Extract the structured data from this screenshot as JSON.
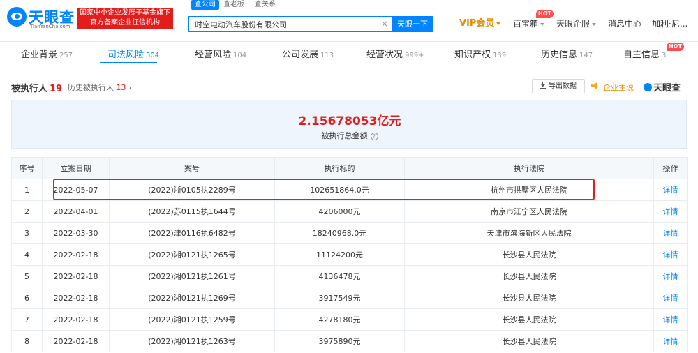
{
  "header": {
    "logo_name": "天眼查",
    "logo_domain": "TianYanCha.com",
    "gov_badge_line1": "国家中小企业发展子基金旗下",
    "gov_badge_line2": "官方备案企业征信机构",
    "search_tabs": [
      "查公司",
      "查老板",
      "查关系"
    ],
    "search_value": "时空电动汽车股份有限公司",
    "search_button": "天眼一下",
    "nav": {
      "vip": "VIP会员",
      "treasure": "百宝箱",
      "treasure_badge": "HOT",
      "enterprise": "天眼企服",
      "messages": "消息中心",
      "user": "加利·尼..."
    }
  },
  "tabs": [
    {
      "label": "企业背景",
      "count": "257"
    },
    {
      "label": "司法风险",
      "count": "504"
    },
    {
      "label": "经营风险",
      "count": "104"
    },
    {
      "label": "公司发展",
      "count": "113"
    },
    {
      "label": "经营状况",
      "count": "999+"
    },
    {
      "label": "知识产权",
      "count": "139"
    },
    {
      "label": "历史信息",
      "count": "147"
    },
    {
      "label": "自主信息",
      "count": "3",
      "badge": "HOT"
    }
  ],
  "section": {
    "title": "被执行人",
    "count": "19",
    "history_label": "历史被执行人",
    "history_count": "13",
    "export_label": "导出数据",
    "pr_label": "企业主说",
    "brand": "天眼查"
  },
  "summary": {
    "amount": "2.15678053亿元",
    "label": "被执行总金额"
  },
  "table": {
    "columns": [
      "序号",
      "立案日期",
      "案号",
      "执行标的",
      "执行法院",
      "操作"
    ],
    "rows": [
      {
        "idx": "1",
        "date": "2022-05-07",
        "case": "(2022)浙0105执2289号",
        "amount": "102651864.0元",
        "court": "杭州市拱墅区人民法院",
        "op": "详情"
      },
      {
        "idx": "2",
        "date": "2022-04-01",
        "case": "(2022)苏0115执1644号",
        "amount": "4206000元",
        "court": "南京市江宁区人民法院",
        "op": "详情"
      },
      {
        "idx": "3",
        "date": "2022-03-30",
        "case": "(2022)津0116执6482号",
        "amount": "18240968.0元",
        "court": "天津市滨海新区人民法院",
        "op": "详情"
      },
      {
        "idx": "4",
        "date": "2022-02-18",
        "case": "(2022)湘0121执1265号",
        "amount": "11124200元",
        "court": "长沙县人民法院",
        "op": "详情"
      },
      {
        "idx": "5",
        "date": "2022-02-18",
        "case": "(2022)湘0121执1261号",
        "amount": "4136478元",
        "court": "长沙县人民法院",
        "op": "详情"
      },
      {
        "idx": "6",
        "date": "2022-02-18",
        "case": "(2022)湘0121执1269号",
        "amount": "3917549元",
        "court": "长沙县人民法院",
        "op": "详情"
      },
      {
        "idx": "7",
        "date": "2022-02-18",
        "case": "(2022)湘0121执1259号",
        "amount": "4278180元",
        "court": "长沙县人民法院",
        "op": "详情"
      },
      {
        "idx": "8",
        "date": "2022-02-18",
        "case": "(2022)湘0121执1263号",
        "amount": "3975890元",
        "court": "长沙县人民法院",
        "op": "详情"
      }
    ]
  },
  "colors": {
    "brand_blue": "#0084ff",
    "alert_red": "#e41c1c",
    "vip_orange": "#e58d00",
    "summary_bg": "#eef5fc"
  }
}
